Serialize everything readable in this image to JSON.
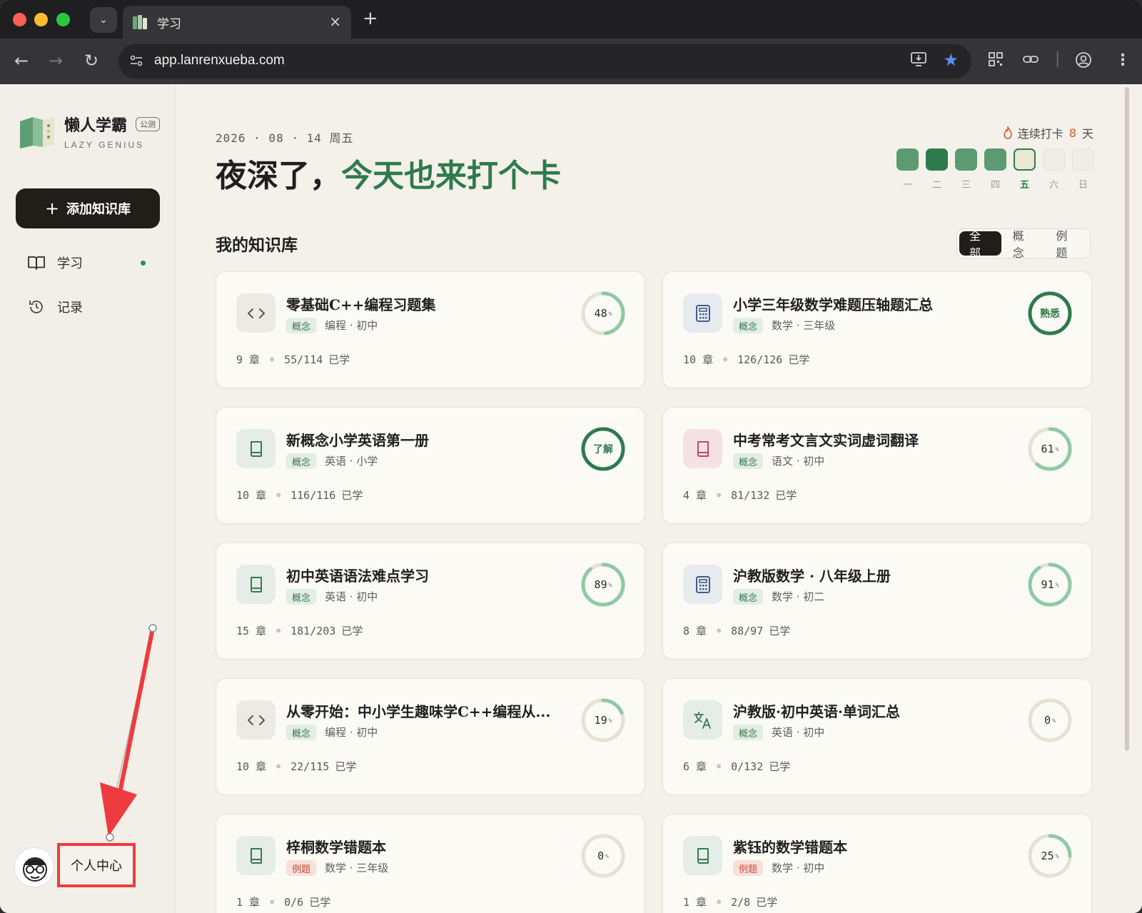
{
  "browser": {
    "tab_title": "学习",
    "url": "app.lanrenxueba.com"
  },
  "brand": {
    "name": "懒人学霸",
    "badge": "公测",
    "subtitle": "LAZY GENIUS"
  },
  "sidebar": {
    "add_button": "添加知识库",
    "items": [
      {
        "label": "学习",
        "icon": "book-icon",
        "active": true
      },
      {
        "label": "记录",
        "icon": "history-icon",
        "active": false
      }
    ],
    "profile_label": "个人中心"
  },
  "header": {
    "date": "2026 · 08 · 14  周五",
    "greeting_plain": "夜深了，",
    "greeting_accent": "今天也来打个卡",
    "streak_prefix": "连续打卡",
    "streak_days": "8",
    "streak_suffix": "天"
  },
  "week": [
    {
      "label": "一",
      "state": "done"
    },
    {
      "label": "二",
      "state": "done-dark"
    },
    {
      "label": "三",
      "state": "done"
    },
    {
      "label": "四",
      "state": "done"
    },
    {
      "label": "五",
      "state": "today"
    },
    {
      "label": "六",
      "state": "future"
    },
    {
      "label": "日",
      "state": "future"
    }
  ],
  "library": {
    "title": "我的知识库",
    "filters": [
      "全部",
      "概念",
      "例题"
    ],
    "active_filter": "全部",
    "cards": [
      {
        "title": "零基础C++编程习题集",
        "tag": "概念",
        "tag_type": "concept",
        "meta": "编程 · 初中",
        "chapters": "9 章",
        "progress_text": "55/114",
        "learned": "已学",
        "icon": "code-icon",
        "ring_value": "48",
        "ring_unit": "%",
        "ring_fraction": 0.48
      },
      {
        "title": "小学三年级数学难题压轴题汇总",
        "tag": "概念",
        "tag_type": "concept",
        "meta": "数学 · 三年级",
        "chapters": "10 章",
        "progress_text": "126/126",
        "learned": "已学",
        "icon": "calculator-icon",
        "ring_value": "熟悉",
        "ring_unit": "",
        "ring_fraction": 1.0
      },
      {
        "title": "新概念小学英语第一册",
        "tag": "概念",
        "tag_type": "concept",
        "meta": "英语 · 小学",
        "chapters": "10 章",
        "progress_text": "116/116",
        "learned": "已学",
        "icon": "book-icon",
        "ring_value": "了解",
        "ring_unit": "",
        "ring_fraction": 1.0
      },
      {
        "title": "中考常考文言文实词虚词翻译",
        "tag": "概念",
        "tag_type": "concept",
        "meta": "语文 · 初中",
        "chapters": "4 章",
        "progress_text": "81/132",
        "learned": "已学",
        "icon": "book-icon",
        "ring_value": "61",
        "ring_unit": "%",
        "ring_fraction": 0.61
      },
      {
        "title": "初中英语语法难点学习",
        "tag": "概念",
        "tag_type": "concept",
        "meta": "英语 · 初中",
        "chapters": "15 章",
        "progress_text": "181/203",
        "learned": "已学",
        "icon": "book-icon",
        "ring_value": "89",
        "ring_unit": "%",
        "ring_fraction": 0.89
      },
      {
        "title": "沪教版数学 · 八年级上册",
        "tag": "概念",
        "tag_type": "concept",
        "meta": "数学 · 初二",
        "chapters": "8 章",
        "progress_text": "88/97",
        "learned": "已学",
        "icon": "calculator-icon",
        "ring_value": "91",
        "ring_unit": "%",
        "ring_fraction": 0.91
      },
      {
        "title": "从零开始：中小学生趣味学C++编程从...",
        "tag": "概念",
        "tag_type": "concept",
        "meta": "编程 · 初中",
        "chapters": "10 章",
        "progress_text": "22/115",
        "learned": "已学",
        "icon": "code-icon",
        "ring_value": "19",
        "ring_unit": "%",
        "ring_fraction": 0.19
      },
      {
        "title": "沪教版·初中英语·单词汇总",
        "tag": "概念",
        "tag_type": "concept",
        "meta": "英语 · 初中",
        "chapters": "6 章",
        "progress_text": "0/132",
        "learned": "已学",
        "icon": "translate-icon",
        "ring_value": "0",
        "ring_unit": "%",
        "ring_fraction": 0
      },
      {
        "title": "梓桐数学错题本",
        "tag": "例题",
        "tag_type": "example",
        "meta": "数学 · 三年级",
        "chapters": "1 章",
        "progress_text": "0/6",
        "learned": "已学",
        "icon": "book-icon",
        "ring_value": "0",
        "ring_unit": "%",
        "ring_fraction": 0
      },
      {
        "title": "紫钰的数学错题本",
        "tag": "例题",
        "tag_type": "example",
        "meta": "数学 · 初中",
        "chapters": "1 章",
        "progress_text": "2/8",
        "learned": "已学",
        "icon": "book-icon",
        "ring_value": "25",
        "ring_unit": "%",
        "ring_fraction": 0.25
      }
    ]
  },
  "colors": {
    "accent": "#2f7a4c",
    "ring_track": "#e5e1d3",
    "ring_light": "#8fcaa2",
    "ring_dark": "#2f7a4c",
    "annotation_red": "#ee3b3f"
  }
}
